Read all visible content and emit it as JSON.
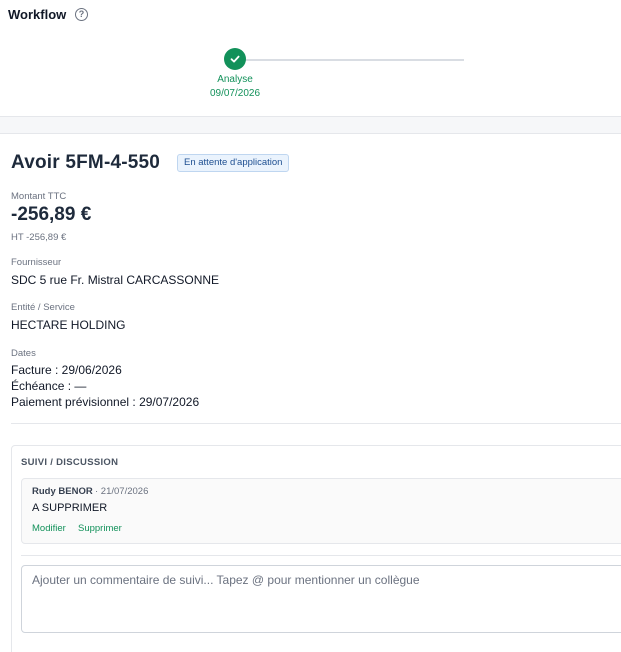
{
  "workflow": {
    "title": "Workflow",
    "help_icon_glyph": "?",
    "steps": [
      {
        "label": "Analyse",
        "date": "09/07/2026",
        "status": "done"
      }
    ]
  },
  "document": {
    "title": "Avoir 5FM-4-550",
    "status_badge": "En attente d'application",
    "amount_label": "Montant TTC",
    "amount_value": "-256,89 €",
    "ht_label": "HT",
    "ht_value": "-256,89 €",
    "supplier_label": "Fournisseur",
    "supplier_value": "SDC 5 rue Fr. Mistral CARCASSONNE",
    "entity_label": "Entité / Service",
    "entity_value": "HECTARE HOLDING",
    "dates_label": "Dates",
    "invoice_date": "Facture : 29/06/2026",
    "due_date": "Échéance : —",
    "planned_payment": "Paiement prévisionnel : 29/07/2026"
  },
  "discussion": {
    "header": "SUIVI / DISCUSSION",
    "comments": [
      {
        "author": "Rudy BENOR",
        "date": "· 21/07/2026",
        "text": "A SUPPRIMER",
        "edit_label": "Modifier",
        "delete_label": "Supprimer"
      }
    ],
    "input_placeholder": "Ajouter un commentaire de suivi... Tapez @ pour mentionner un collègue"
  },
  "colors": {
    "accent_green": "#12915a",
    "badge_bg": "#eaf3fd",
    "badge_text": "#1e4f91"
  },
  "icons": {
    "help": "question-circle-icon",
    "step_done": "check-icon"
  }
}
